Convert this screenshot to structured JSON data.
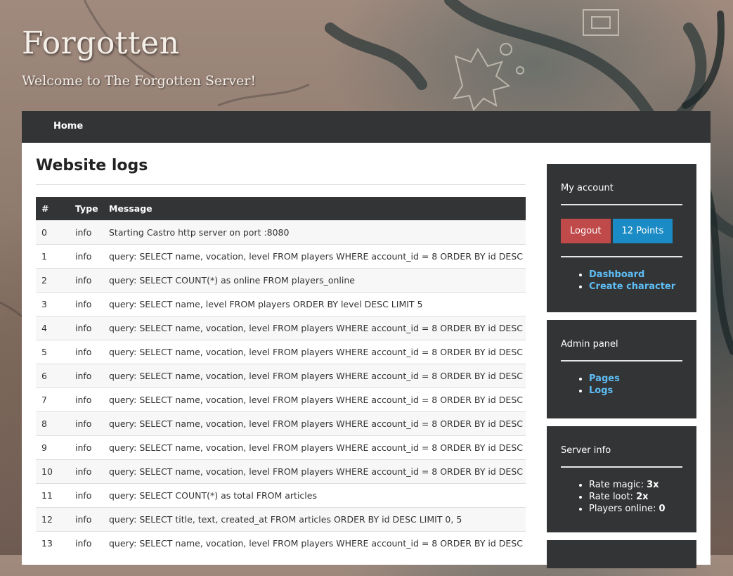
{
  "site": {
    "title": "Forgotten",
    "subtitle": "Welcome to The Forgotten Server!"
  },
  "nav": {
    "items": [
      {
        "label": "Home"
      }
    ]
  },
  "page": {
    "title": "Website logs"
  },
  "table": {
    "headers": [
      "#",
      "Type",
      "Message"
    ],
    "rows": [
      {
        "id": "0",
        "type": "info",
        "message": "Starting Castro http server on port :8080"
      },
      {
        "id": "1",
        "type": "info",
        "message": "query: SELECT name, vocation, level FROM players WHERE account_id = 8 ORDER BY id DESC"
      },
      {
        "id": "2",
        "type": "info",
        "message": "query: SELECT COUNT(*) as online FROM players_online"
      },
      {
        "id": "3",
        "type": "info",
        "message": "query: SELECT name, level FROM players ORDER BY level DESC LIMIT 5"
      },
      {
        "id": "4",
        "type": "info",
        "message": "query: SELECT name, vocation, level FROM players WHERE account_id = 8 ORDER BY id DESC"
      },
      {
        "id": "5",
        "type": "info",
        "message": "query: SELECT name, vocation, level FROM players WHERE account_id = 8 ORDER BY id DESC"
      },
      {
        "id": "6",
        "type": "info",
        "message": "query: SELECT name, vocation, level FROM players WHERE account_id = 8 ORDER BY id DESC"
      },
      {
        "id": "7",
        "type": "info",
        "message": "query: SELECT name, vocation, level FROM players WHERE account_id = 8 ORDER BY id DESC"
      },
      {
        "id": "8",
        "type": "info",
        "message": "query: SELECT name, vocation, level FROM players WHERE account_id = 8 ORDER BY id DESC"
      },
      {
        "id": "9",
        "type": "info",
        "message": "query: SELECT name, vocation, level FROM players WHERE account_id = 8 ORDER BY id DESC"
      },
      {
        "id": "10",
        "type": "info",
        "message": "query: SELECT name, vocation, level FROM players WHERE account_id = 8 ORDER BY id DESC"
      },
      {
        "id": "11",
        "type": "info",
        "message": "query: SELECT COUNT(*) as total FROM articles"
      },
      {
        "id": "12",
        "type": "info",
        "message": "query: SELECT title, text, created_at FROM articles ORDER BY id DESC LIMIT 0, 5"
      },
      {
        "id": "13",
        "type": "info",
        "message": "query: SELECT name, vocation, level FROM players WHERE account_id = 8 ORDER BY id DESC"
      }
    ]
  },
  "sidebar": {
    "account": {
      "title": "My account",
      "logout_label": "Logout",
      "points_label": "12 Points",
      "links": [
        {
          "label": "Dashboard"
        },
        {
          "label": "Create character"
        }
      ]
    },
    "admin": {
      "title": "Admin panel",
      "links": [
        {
          "label": "Pages"
        },
        {
          "label": "Logs"
        }
      ]
    },
    "server": {
      "title": "Server info",
      "stats": [
        {
          "label": "Rate magic:",
          "value": "3x"
        },
        {
          "label": "Rate loot:",
          "value": "2x"
        },
        {
          "label": "Players online:",
          "value": "0"
        }
      ]
    }
  },
  "colors": {
    "navbar": "#333435",
    "logout": "#c0494a",
    "points": "#1a8bc4",
    "link": "#5dbdf5"
  }
}
